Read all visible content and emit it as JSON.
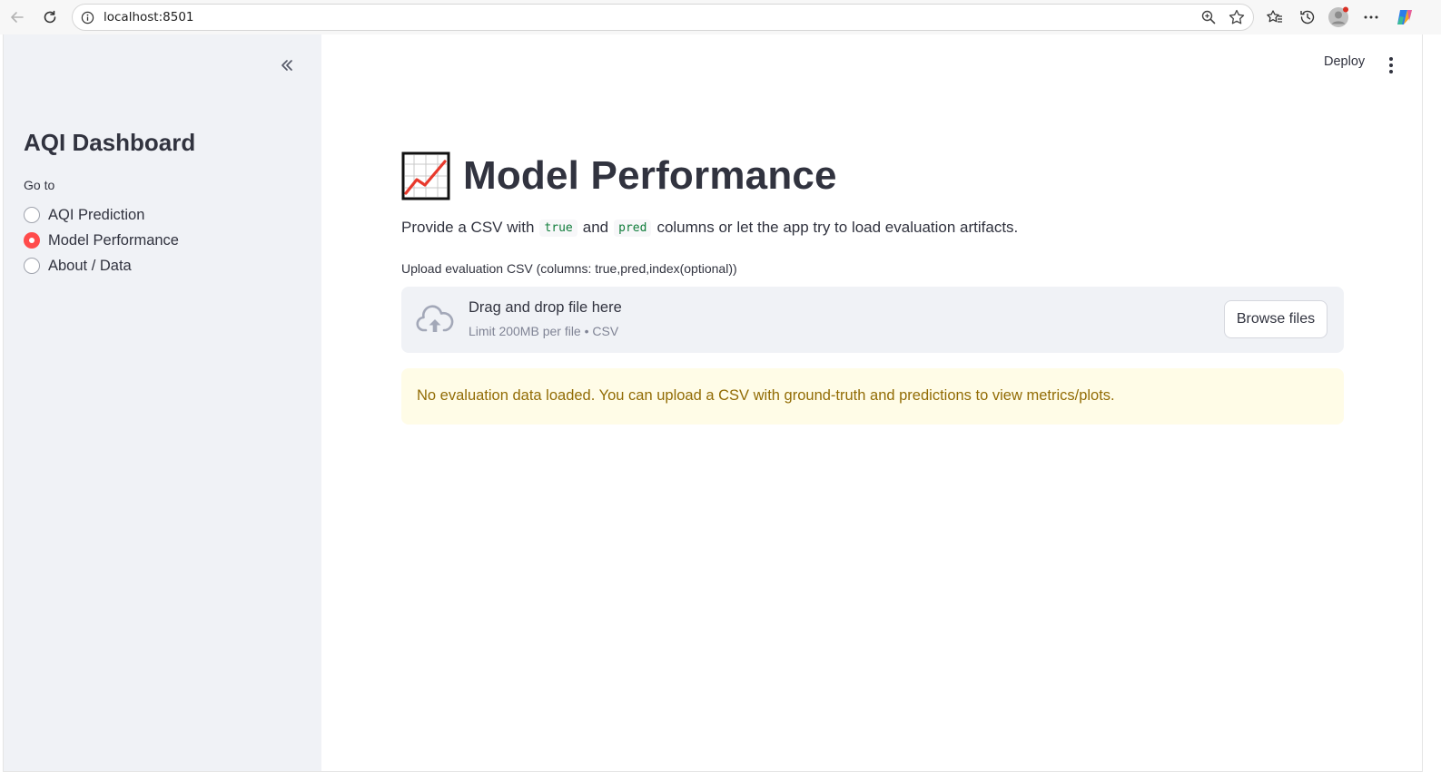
{
  "browser": {
    "url": "localhost:8501",
    "icons": [
      "back-arrow-icon",
      "reload-icon",
      "site-info-icon",
      "zoom-icon",
      "bookmark-star-icon",
      "favorites-icon",
      "history-icon",
      "profile-avatar-icon",
      "more-menu-icon",
      "copilot-icon"
    ]
  },
  "sidebar": {
    "title": "AQI Dashboard",
    "nav_label": "Go to",
    "options": [
      {
        "label": "AQI Prediction",
        "selected": false
      },
      {
        "label": "Model Performance",
        "selected": true
      },
      {
        "label": "About / Data",
        "selected": false
      }
    ]
  },
  "header": {
    "deploy_label": "Deploy"
  },
  "main": {
    "title": "Model Performance",
    "title_icon": "chart-increasing-icon",
    "description": {
      "prefix": "Provide a CSV with",
      "code1": "true",
      "middle": "and",
      "code2": "pred",
      "suffix": "columns or let the app try to load evaluation artifacts."
    },
    "upload": {
      "label": "Upload evaluation CSV (columns: true,pred,index(optional))",
      "drop_text": "Drag and drop file here",
      "limit_text": "Limit 200MB per file • CSV",
      "browse_label": "Browse files"
    },
    "alert": {
      "text": "No evaluation data loaded. You can upload a CSV with ground-truth and predictions to view metrics/plots."
    }
  },
  "colors": {
    "accent": "#ff4b4b",
    "sidebar_bg": "#f0f2f6",
    "alert_bg": "#fffce7",
    "alert_text": "#926c05",
    "text": "#31333f"
  }
}
